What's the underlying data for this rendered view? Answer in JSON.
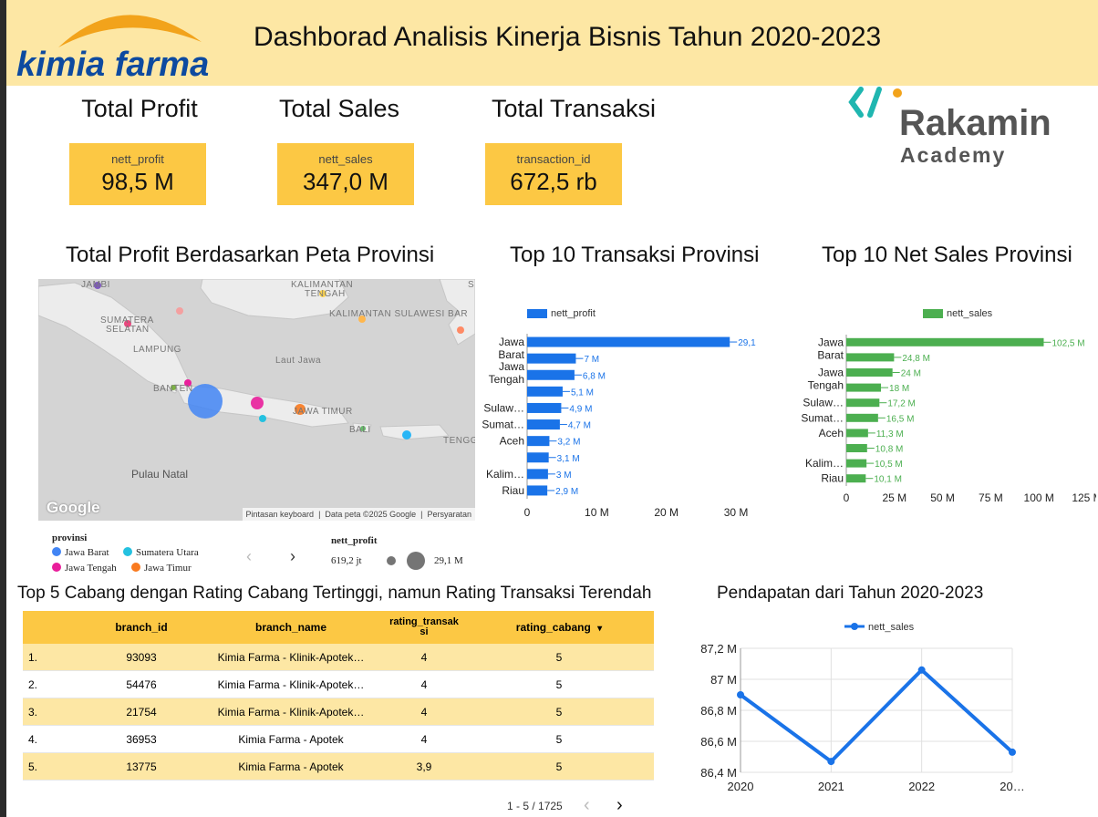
{
  "header": {
    "logo_text": "kimia farma",
    "title": "Dashborad Analisis Kinerja Bisnis Tahun 2020-2023",
    "partner_logo_line1": "Rakamin",
    "partner_logo_line2": "Academy"
  },
  "kpis": [
    {
      "title": "Total Profit",
      "label": "nett_profit",
      "value": "98,5 M"
    },
    {
      "title": "Total Sales",
      "label": "nett_sales",
      "value": "347,0 M"
    },
    {
      "title": "Total Transaksi",
      "label": "transaction_id",
      "value": "672,5 rb"
    }
  ],
  "map_section": {
    "title": "Total Profit Berdasarkan Peta Provinsi",
    "labels": {
      "jambi": "JAMBI",
      "kaltengah1": "KALIMANTAN",
      "kaltengah2": "TENGAH",
      "sumsel1": "SUMATERA",
      "sumsel2": "SELATAN",
      "kalsel": "KALIMANTAN SULAWESI BAR",
      "lampung": "LAMPUNG",
      "lautjawa": "Laut Jawa",
      "banten": "BANTEN",
      "jatim": "JAWA TIMUR",
      "bali": "BALI",
      "tengg": "TENGG",
      "pulaunatal": "Pulau Natal",
      "google": "Google",
      "s": "S"
    },
    "footer": {
      "shortcuts": "Pintasan keyboard",
      "mapdata": "Data peta ©2025 Google",
      "terms": "Persyaratan"
    },
    "legend": {
      "title": "provinsi",
      "items": [
        {
          "label": "Jawa Barat",
          "color": "#4285f4"
        },
        {
          "label": "Sumatera Utara",
          "color": "#24c1e0"
        },
        {
          "label": "Jawa Tengah",
          "color": "#e91e9b"
        },
        {
          "label": "Jawa Timur",
          "color": "#f97a1f"
        }
      ],
      "size_title": "nett_profit",
      "size_min": "619,2 jt",
      "size_max": "29,1 M"
    }
  },
  "top_transaksi": {
    "title": "Top 10 Transaksi Provinsi"
  },
  "top_sales": {
    "title": "Top 10 Net Sales Provinsi"
  },
  "table": {
    "title": "Top 5 Cabang dengan Rating Cabang Tertinggi, namun Rating Transaksi Terendah",
    "columns": [
      "branch_id",
      "branch_name",
      "rating_transaksi",
      "rating_cabang"
    ],
    "sort_icon": "▾",
    "rows": [
      {
        "no": "1.",
        "branch_id": "93093",
        "branch_name": "Kimia Farma - Klinik-Apotek…",
        "rating_transaksi": "4",
        "rating_cabang": "5"
      },
      {
        "no": "2.",
        "branch_id": "54476",
        "branch_name": "Kimia Farma - Klinik-Apotek…",
        "rating_transaksi": "4",
        "rating_cabang": "5"
      },
      {
        "no": "3.",
        "branch_id": "21754",
        "branch_name": "Kimia Farma - Klinik-Apotek…",
        "rating_transaksi": "4",
        "rating_cabang": "5"
      },
      {
        "no": "4.",
        "branch_id": "36953",
        "branch_name": "Kimia Farma - Apotek",
        "rating_transaksi": "4",
        "rating_cabang": "5"
      },
      {
        "no": "5.",
        "branch_id": "13775",
        "branch_name": "Kimia Farma - Apotek",
        "rating_transaksi": "3,9",
        "rating_cabang": "5"
      }
    ],
    "pagination": "1 - 5 / 1725"
  },
  "line_section": {
    "title": "Pendapatan dari Tahun 2020-2023"
  },
  "icons": {
    "prev": "chevron-left-icon",
    "next": "chevron-right-icon"
  },
  "colors": {
    "header_bg": "#fde7a4",
    "accent": "#fcc844",
    "blue": "#1a73e8",
    "green": "#4caf50",
    "brand_blue": "#0d4aa0",
    "brand_orange": "#f2a31b"
  },
  "chart_data": [
    {
      "type": "bar",
      "orientation": "horizontal",
      "title": "Top 10 Transaksi Provinsi",
      "series": [
        {
          "name": "nett_profit",
          "color": "#1a73e8",
          "values": [
            29.1,
            7,
            6.8,
            5.1,
            4.9,
            4.7,
            3.2,
            3.1,
            3,
            2.9
          ]
        }
      ],
      "categories": [
        "Jawa Barat",
        "Jawa Tengah",
        "",
        "Sulaw…",
        "Sumat…",
        "Aceh",
        "",
        "Kalim…",
        "Riau",
        ""
      ],
      "data_labels": [
        "29,1",
        "7 M",
        "6,8 M",
        "5,1 M",
        "4,9 M",
        "4,7 M",
        "3,2 M",
        "3,1 M",
        "3 M",
        "2,9 M"
      ],
      "category_labels": [
        {
          "row": 0,
          "lines": [
            "Jawa",
            "Barat"
          ]
        },
        {
          "row": 1.5,
          "lines": [
            "Jawa",
            "Tengah"
          ]
        },
        {
          "row": 4,
          "lines": [
            "Sulaw…"
          ]
        },
        {
          "row": 5,
          "lines": [
            "Sumat…"
          ]
        },
        {
          "row": 6,
          "lines": [
            "Aceh"
          ]
        },
        {
          "row": 8,
          "lines": [
            "Kalim…"
          ]
        },
        {
          "row": 9,
          "lines": [
            "Riau"
          ]
        }
      ],
      "xlim": [
        0,
        33
      ],
      "xticks": [
        0,
        10,
        20,
        30
      ],
      "xtick_labels": [
        "0",
        "10 M",
        "20 M",
        "30 M"
      ]
    },
    {
      "type": "bar",
      "orientation": "horizontal",
      "title": "Top 10 Net Sales Provinsi",
      "series": [
        {
          "name": "nett_sales",
          "color": "#4caf50",
          "values": [
            102.5,
            24.8,
            24,
            18,
            17.2,
            16.5,
            11.3,
            10.8,
            10.5,
            10.1
          ]
        }
      ],
      "data_labels": [
        "102,5 M",
        "24,8 M",
        "24 M",
        "18 M",
        "17,2 M",
        "16,5 M",
        "11,3 M",
        "10,8 M",
        "10,5 M",
        "10,1 M"
      ],
      "category_labels": [
        {
          "row": 0,
          "lines": [
            "Jawa",
            "Barat"
          ]
        },
        {
          "row": 2,
          "lines": [
            "Jawa",
            "Tengah"
          ]
        },
        {
          "row": 4,
          "lines": [
            "Sulaw…"
          ]
        },
        {
          "row": 5,
          "lines": [
            "Sumat…"
          ]
        },
        {
          "row": 6,
          "lines": [
            "Aceh"
          ]
        },
        {
          "row": 8,
          "lines": [
            "Kalim…"
          ]
        },
        {
          "row": 9,
          "lines": [
            "Riau"
          ]
        }
      ],
      "xlim": [
        0,
        125
      ],
      "xticks": [
        0,
        25,
        50,
        75,
        100,
        125
      ],
      "xtick_labels": [
        "0",
        "25 M",
        "50 M",
        "75 M",
        "100 M",
        "125 M"
      ]
    },
    {
      "type": "line",
      "title": "Pendapatan dari Tahun 2020-2023",
      "series": [
        {
          "name": "nett_sales",
          "color": "#1a73e8",
          "values": [
            86.9,
            86.47,
            87.06,
            86.53
          ]
        }
      ],
      "x": [
        "2020",
        "2021",
        "2022",
        "2023"
      ],
      "xtick_labels": [
        "2020",
        "2021",
        "2022",
        "20…"
      ],
      "ylim": [
        86.4,
        87.2
      ],
      "yticks": [
        86.4,
        86.6,
        86.8,
        87.0,
        87.2
      ],
      "ytick_labels": [
        "86,4 M",
        "86,6 M",
        "86,8 M",
        "87 M",
        "87,2 M"
      ],
      "grid": true
    }
  ]
}
